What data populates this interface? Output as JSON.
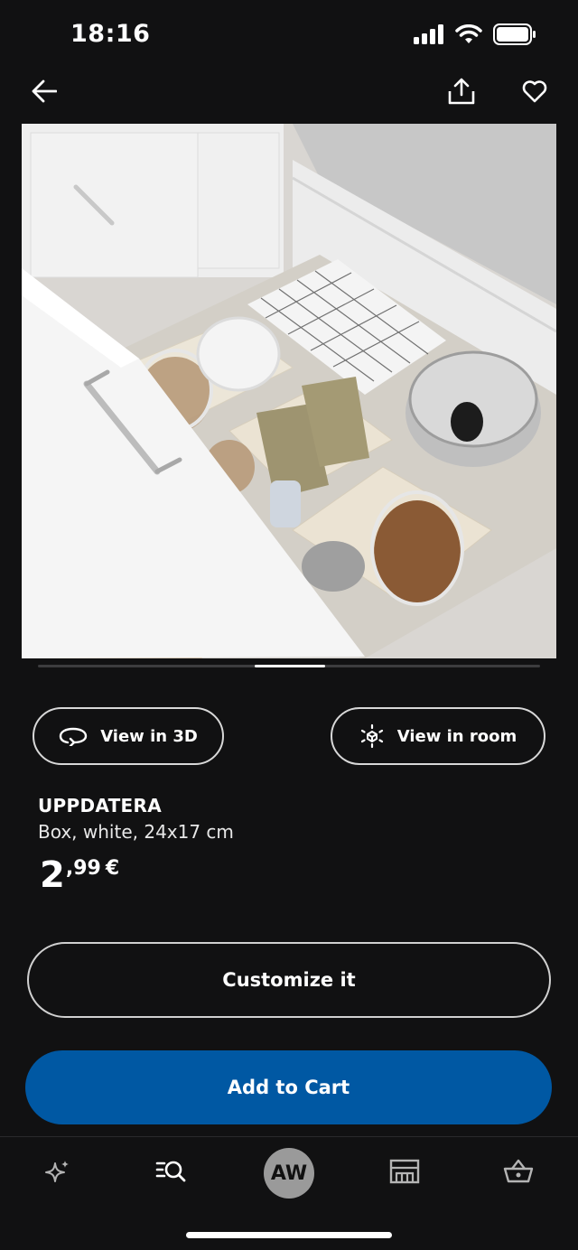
{
  "status_bar": {
    "time": "18:16",
    "icons": [
      "signal-icon",
      "wifi-icon",
      "battery-icon"
    ]
  },
  "top_nav": {
    "icons": [
      "back-arrow-icon",
      "share-icon",
      "heart-icon"
    ]
  },
  "product_image": {
    "description_icon": "product-photo"
  },
  "carousel": {
    "active_index": 4,
    "progress": 0.45
  },
  "actions": {
    "view_3d_label": "View in 3D",
    "view_room_label": "View in room"
  },
  "product": {
    "name": "UPPDATERA",
    "description": "Box, white, 24x17 cm",
    "price_int": "2",
    "price_dec": ",99",
    "price_currency": "€"
  },
  "buttons": {
    "customize_label": "Customize it",
    "add_to_cart_label": "Add to Cart"
  },
  "tabbar": {
    "account_initials": "AW",
    "icons": [
      "sparkle-icon",
      "search-list-icon",
      "store-icon",
      "basket-icon"
    ]
  },
  "colors": {
    "background": "#111112",
    "primary_blue": "#0058a3",
    "text": "#ffffff",
    "avatar_bg": "#9a9a9a"
  }
}
